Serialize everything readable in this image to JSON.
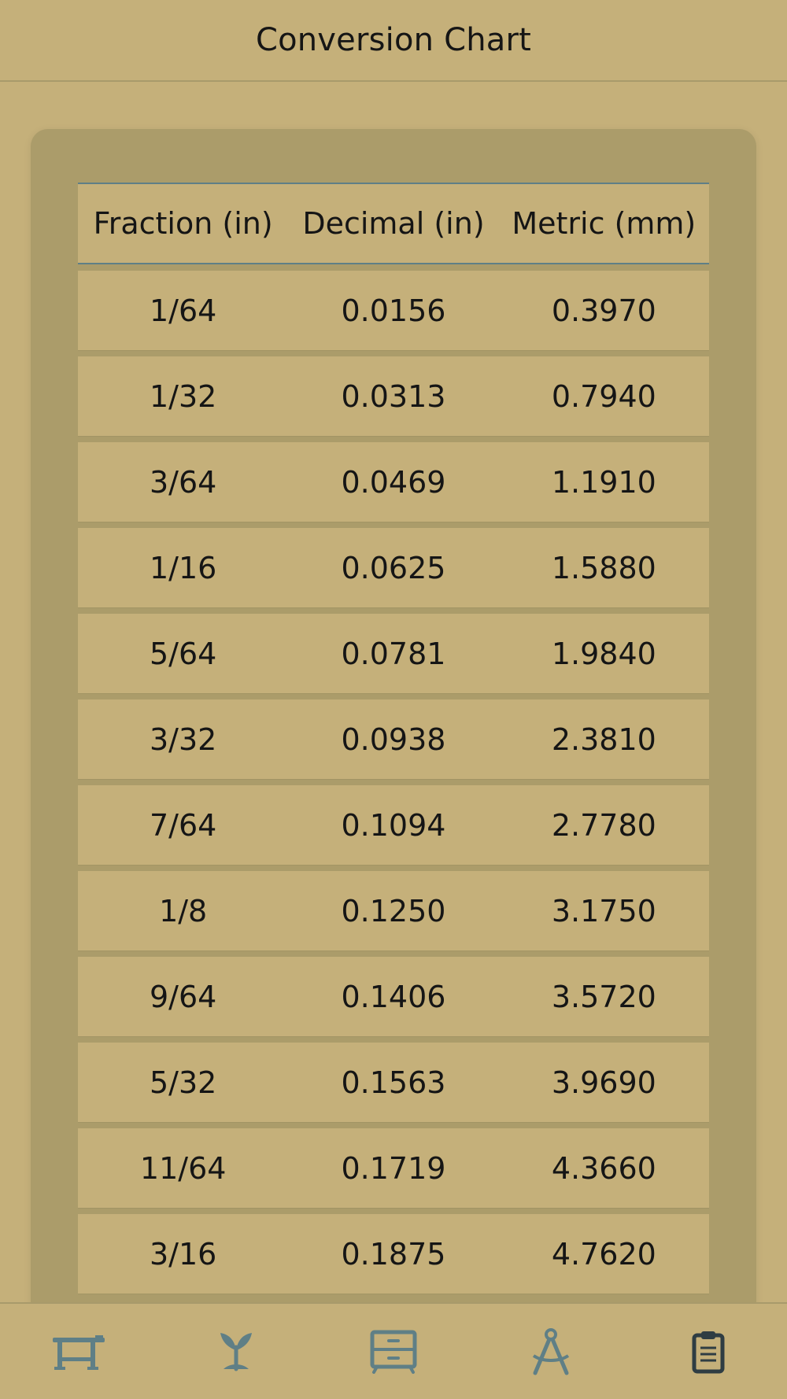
{
  "header": {
    "title": "Conversion Chart"
  },
  "table": {
    "columns": [
      "Fraction (in)",
      "Decimal (in)",
      "Metric (mm)"
    ],
    "rows": [
      [
        "1/64",
        "0.0156",
        "0.3970"
      ],
      [
        "1/32",
        "0.0313",
        "0.7940"
      ],
      [
        "3/64",
        "0.0469",
        "1.1910"
      ],
      [
        "1/16",
        "0.0625",
        "1.5880"
      ],
      [
        "5/64",
        "0.0781",
        "1.9840"
      ],
      [
        "3/32",
        "0.0938",
        "2.3810"
      ],
      [
        "7/64",
        "0.1094",
        "2.7780"
      ],
      [
        "1/8",
        "0.1250",
        "3.1750"
      ],
      [
        "9/64",
        "0.1406",
        "3.5720"
      ],
      [
        "5/32",
        "0.1563",
        "3.9690"
      ],
      [
        "11/64",
        "0.1719",
        "4.3660"
      ],
      [
        "3/16",
        "0.1875",
        "4.7620"
      ]
    ]
  },
  "tabbar": {
    "items": [
      {
        "icon": "workbench-icon",
        "selected": false
      },
      {
        "icon": "sprout-icon",
        "selected": false
      },
      {
        "icon": "dresser-icon",
        "selected": false
      },
      {
        "icon": "drafting-compass-icon",
        "selected": false
      },
      {
        "icon": "clipboard-icon",
        "selected": true
      }
    ]
  },
  "colors": {
    "background": "#c5b07a",
    "card": "#ab9c6a",
    "accent": "#5f7f86",
    "active_icon": "#2f3d43",
    "text": "#151515"
  }
}
